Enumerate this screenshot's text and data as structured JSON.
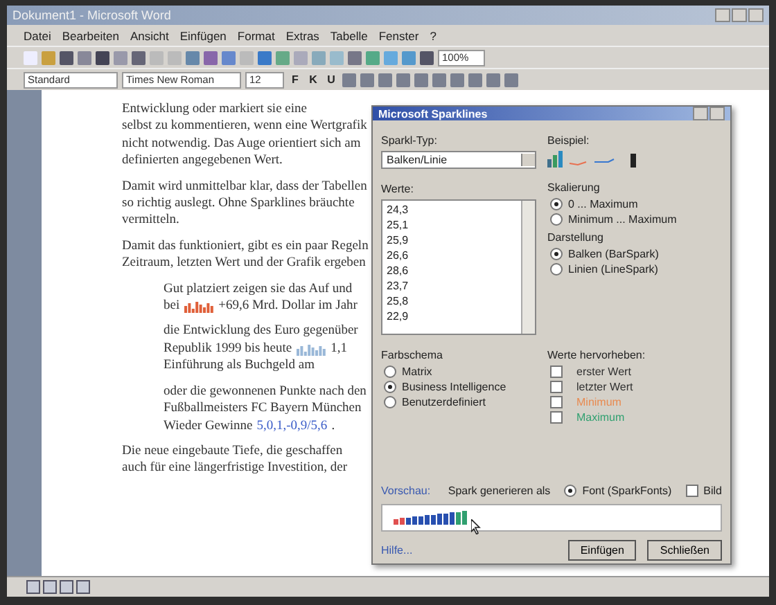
{
  "window": {
    "title": "Dokument1 - Microsoft Word"
  },
  "menu": [
    "Datei",
    "Bearbeiten",
    "Ansicht",
    "Einfügen",
    "Format",
    "Extras",
    "Tabelle",
    "Fenster",
    "?"
  ],
  "toolbar": {
    "zoom": "100%"
  },
  "format_bar": {
    "style": "Standard",
    "font": "Times New Roman",
    "size": "12",
    "text_buttons": [
      "F",
      "K",
      "U"
    ]
  },
  "document": {
    "paragraphs": [
      {
        "kind": "body",
        "lines": [
          "Entwicklung oder markiert sie eine",
          "selbst zu kommentieren, wenn eine Wertgrafik",
          "nicht notwendig. Das Auge orientiert sich am",
          "definierten angegebenen Wert."
        ]
      },
      {
        "kind": "body",
        "lines": [
          "Damit wird unmittelbar klar, dass der Tabellen",
          "so richtig auslegt. Ohne Sparklines bräuchte",
          "vermitteln."
        ]
      },
      {
        "kind": "body",
        "lines": [
          "Damit das funktioniert, gibt es ein paar Regeln",
          "Zeitraum, letzten Wert und der Grafik ergeben"
        ]
      },
      {
        "kind": "indent",
        "lines": [
          "Gut platziert zeigen sie das Auf und",
          {
            "before": "bei",
            "kind": "spark",
            "color": "#e0603a",
            "after": "+69,6 Mrd. Dollar im Jahr"
          }
        ]
      },
      {
        "kind": "indent",
        "lines": [
          "die Entwicklung des Euro gegenüber",
          {
            "before": "Republik 1999 bis heute",
            "kind": "spark",
            "color": "#9ab8d8",
            "after": "1,1"
          },
          "Einführung als Buchgeld am"
        ]
      },
      {
        "kind": "indent",
        "lines": [
          "oder die gewonnenen Punkte nach den",
          "Fußballmeisters FC Bayern München",
          {
            "before": "Wieder Gewinne",
            "kind": "colored",
            "colored": "5,0,1,-0,9/5,6",
            "color": "#3a5cc8",
            "after": "."
          }
        ]
      },
      {
        "kind": "body",
        "lines": [
          "Die neue eingebaute Tiefe, die geschaffen",
          "auch für eine längerfristige Investition, der"
        ]
      }
    ]
  },
  "dialog": {
    "title": "Microsoft Sparklines",
    "type_label": "Sparkl-Typ:",
    "type_value": "Balken/Linie",
    "values_label": "Werte:",
    "values": [
      "24,3",
      "25,1",
      "25,9",
      "26,6",
      "28,6",
      "23,7",
      "25,8",
      "22,9"
    ],
    "example_label": "Beispiel:",
    "scaling_label": "Skalierung",
    "scaling": [
      {
        "label": "0 ... Maximum",
        "selected": true
      },
      {
        "label": "Minimum ... Maximum",
        "selected": false
      }
    ],
    "display_label": "Darstellung",
    "display": [
      {
        "label": "Balken (BarSpark)",
        "selected": true
      },
      {
        "label": "Linien (LineSpark)",
        "selected": false
      }
    ],
    "scheme_label": "Farbschema",
    "schemes": [
      {
        "label": "Matrix",
        "selected": false
      },
      {
        "label": "Business Intelligence",
        "selected": true
      },
      {
        "label": "Benutzerdefiniert",
        "selected": false
      }
    ],
    "highlight_label": "Werte hervorheben:",
    "highlights": [
      {
        "label": "erster Wert",
        "checked": false,
        "color": "#303030"
      },
      {
        "label": "letzter Wert",
        "checked": false,
        "color": "#303030"
      },
      {
        "label": "Minimum",
        "checked": false,
        "color": "#e88a50"
      },
      {
        "label": "Maximum",
        "checked": false,
        "color": "#30a070"
      }
    ],
    "preview_label": "Vorschau:",
    "generate_label": "Spark generieren als",
    "generate": [
      {
        "kind": "radio",
        "label": "Font (SparkFonts)",
        "selected": true
      },
      {
        "kind": "check",
        "label": "Bild",
        "checked": false
      }
    ],
    "help_link": "Hilfe...",
    "buttons": [
      "Einfügen",
      "Schließen"
    ]
  }
}
